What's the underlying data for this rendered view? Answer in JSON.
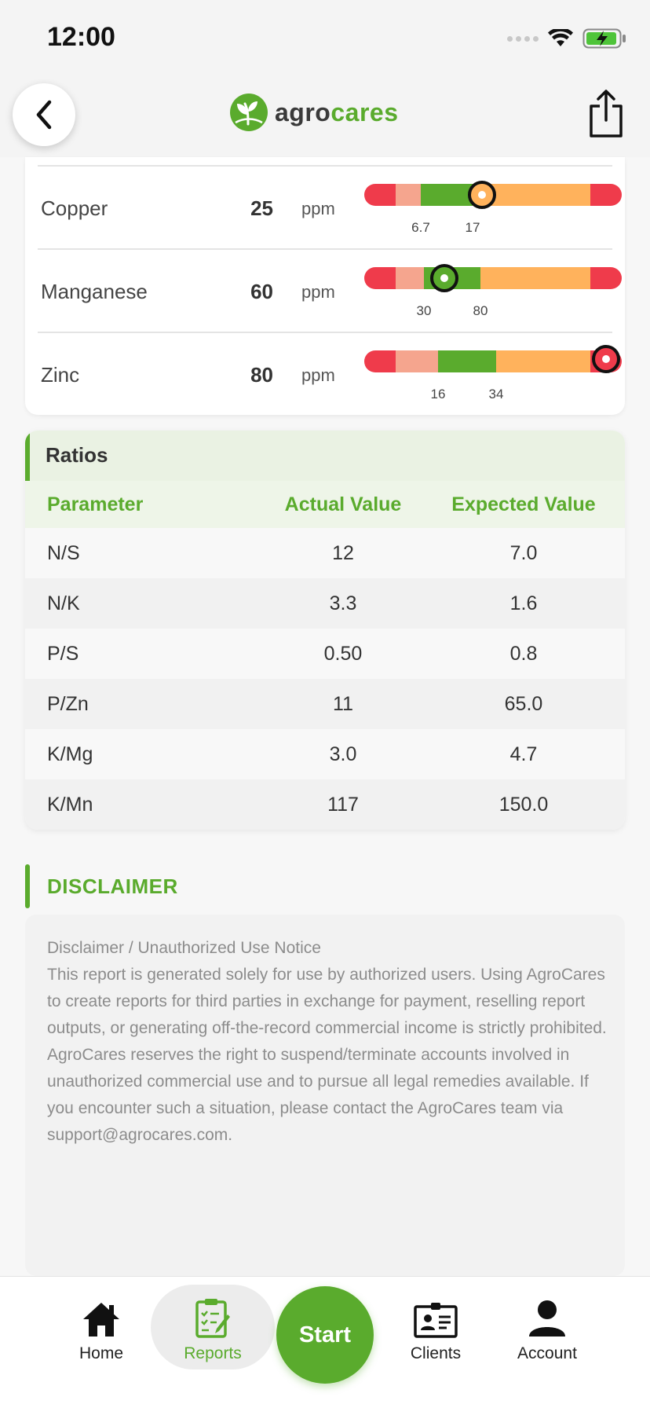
{
  "status_bar": {
    "time": "12:00"
  },
  "header": {
    "logo_text_part1": "agro",
    "logo_text_part2": "cares"
  },
  "nutrients": [
    {
      "name": "Copper",
      "value": "25",
      "unit": "ppm",
      "tick_low": "6.7",
      "tick_high": "17",
      "status": "high"
    },
    {
      "name": "Manganese",
      "value": "60",
      "unit": "ppm",
      "tick_low": "30",
      "tick_high": "80",
      "status": "optimal"
    },
    {
      "name": "Zinc",
      "value": "80",
      "unit": "ppm",
      "tick_low": "16",
      "tick_high": "34",
      "status": "very-high"
    }
  ],
  "ratios": {
    "title": "Ratios",
    "headers": {
      "parameter": "Parameter",
      "actual": "Actual Value",
      "expected": "Expected Value"
    },
    "rows": [
      {
        "parameter": "N/S",
        "actual": "12",
        "expected": "7.0"
      },
      {
        "parameter": "N/K",
        "actual": "3.3",
        "expected": "1.6"
      },
      {
        "parameter": "P/S",
        "actual": "0.50",
        "expected": "0.8"
      },
      {
        "parameter": "P/Zn",
        "actual": "11",
        "expected": "65.0"
      },
      {
        "parameter": "K/Mg",
        "actual": "3.0",
        "expected": "4.7"
      },
      {
        "parameter": "K/Mn",
        "actual": "117",
        "expected": "150.0"
      }
    ]
  },
  "disclaimer": {
    "heading": "DISCLAIMER",
    "subtitle": "Disclaimer / Unauthorized Use Notice",
    "body": "This report is generated solely for use by authorized users. Using AgroCares to create reports for third parties in exchange for payment, reselling report outputs, or generating off-the-record commercial income is strictly prohibited. AgroCares reserves the right to suspend/terminate accounts involved in unauthorized commercial use and to pursue all legal remedies available. If you encounter such a situation, please contact the AgroCares team via support@agrocares.com."
  },
  "nav": {
    "home": "Home",
    "reports": "Reports",
    "start": "Start",
    "clients": "Clients",
    "account": "Account",
    "active": "reports"
  },
  "colors": {
    "brand_green": "#5aab2d",
    "very_low": "#ef3b4b",
    "low": "#f5a58e",
    "optimal": "#5aab2d",
    "high": "#ffb25c",
    "very_high": "#ef3b4b"
  }
}
